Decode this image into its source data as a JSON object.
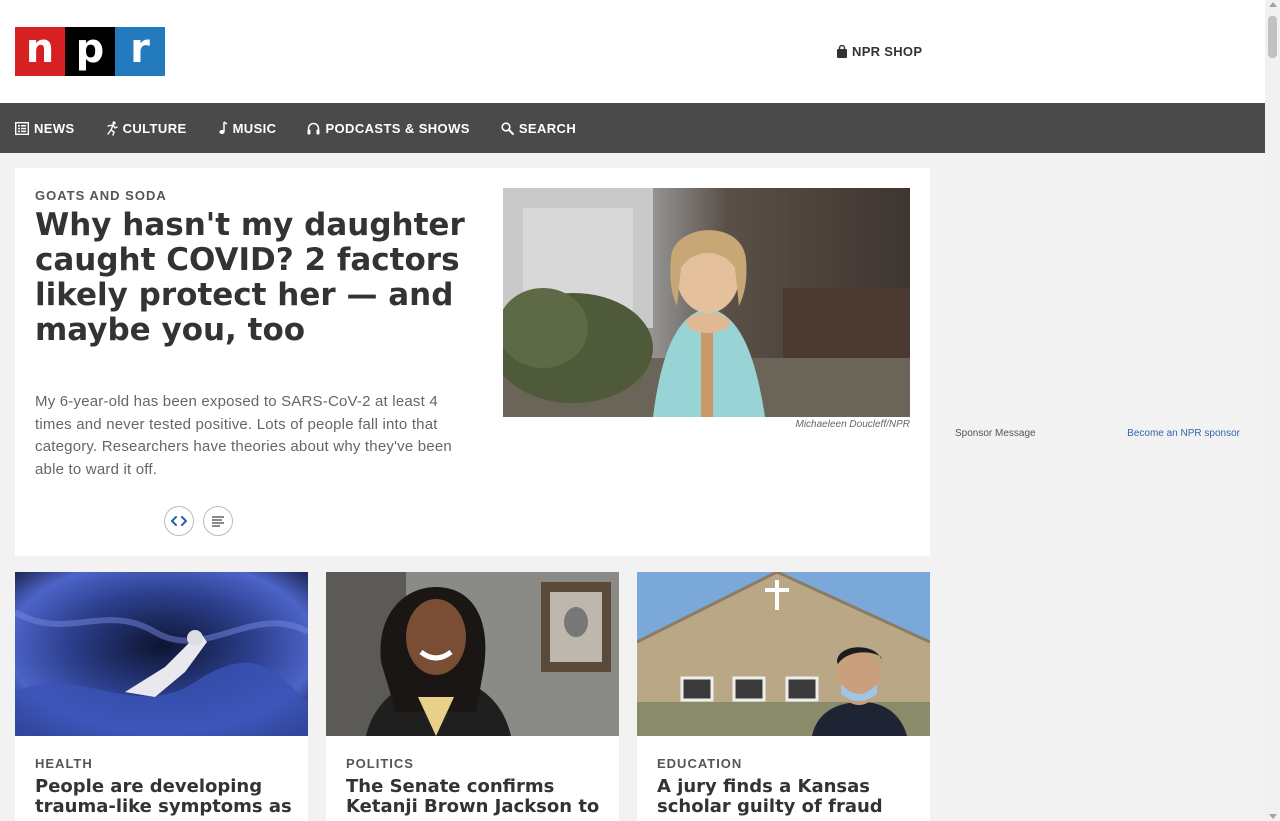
{
  "header": {
    "logo": {
      "letters": [
        "n",
        "p",
        "r"
      ],
      "colors": [
        "#d62021",
        "#000000",
        "#237bbd"
      ]
    },
    "shop_label": "NPR SHOP"
  },
  "nav": {
    "items": [
      {
        "label": "NEWS",
        "icon": "news-icon"
      },
      {
        "label": "CULTURE",
        "icon": "culture-icon"
      },
      {
        "label": "MUSIC",
        "icon": "music-note-icon"
      },
      {
        "label": "PODCASTS & SHOWS",
        "icon": "headphones-icon"
      },
      {
        "label": "SEARCH",
        "icon": "search-icon"
      }
    ]
  },
  "featured": {
    "slug": "GOATS AND SODA",
    "headline": "Why hasn't my daughter caught COVID? 2 factors likely protect her — and maybe you, too",
    "teaser": "My 6-year-old has been exposed to SARS-CoV-2 at least 4 times and never tested positive. Lots of people fall into that category. Researchers have theories about why they've been able to ward it off.",
    "image_credit": "Michaeleen Doucleff/NPR",
    "buttons": [
      "embed-icon",
      "transcript-icon"
    ]
  },
  "sidebar": {
    "sponsor_label": "Sponsor Message",
    "sponsor_link": "Become an NPR sponsor"
  },
  "stories": [
    {
      "slug": "HEALTH",
      "title": "People are developing trauma-like symptoms as"
    },
    {
      "slug": "POLITICS",
      "title": "The Senate confirms Ketanji Brown Jackson to"
    },
    {
      "slug": "EDUCATION",
      "title": "A jury finds a Kansas scholar guilty of fraud"
    }
  ]
}
